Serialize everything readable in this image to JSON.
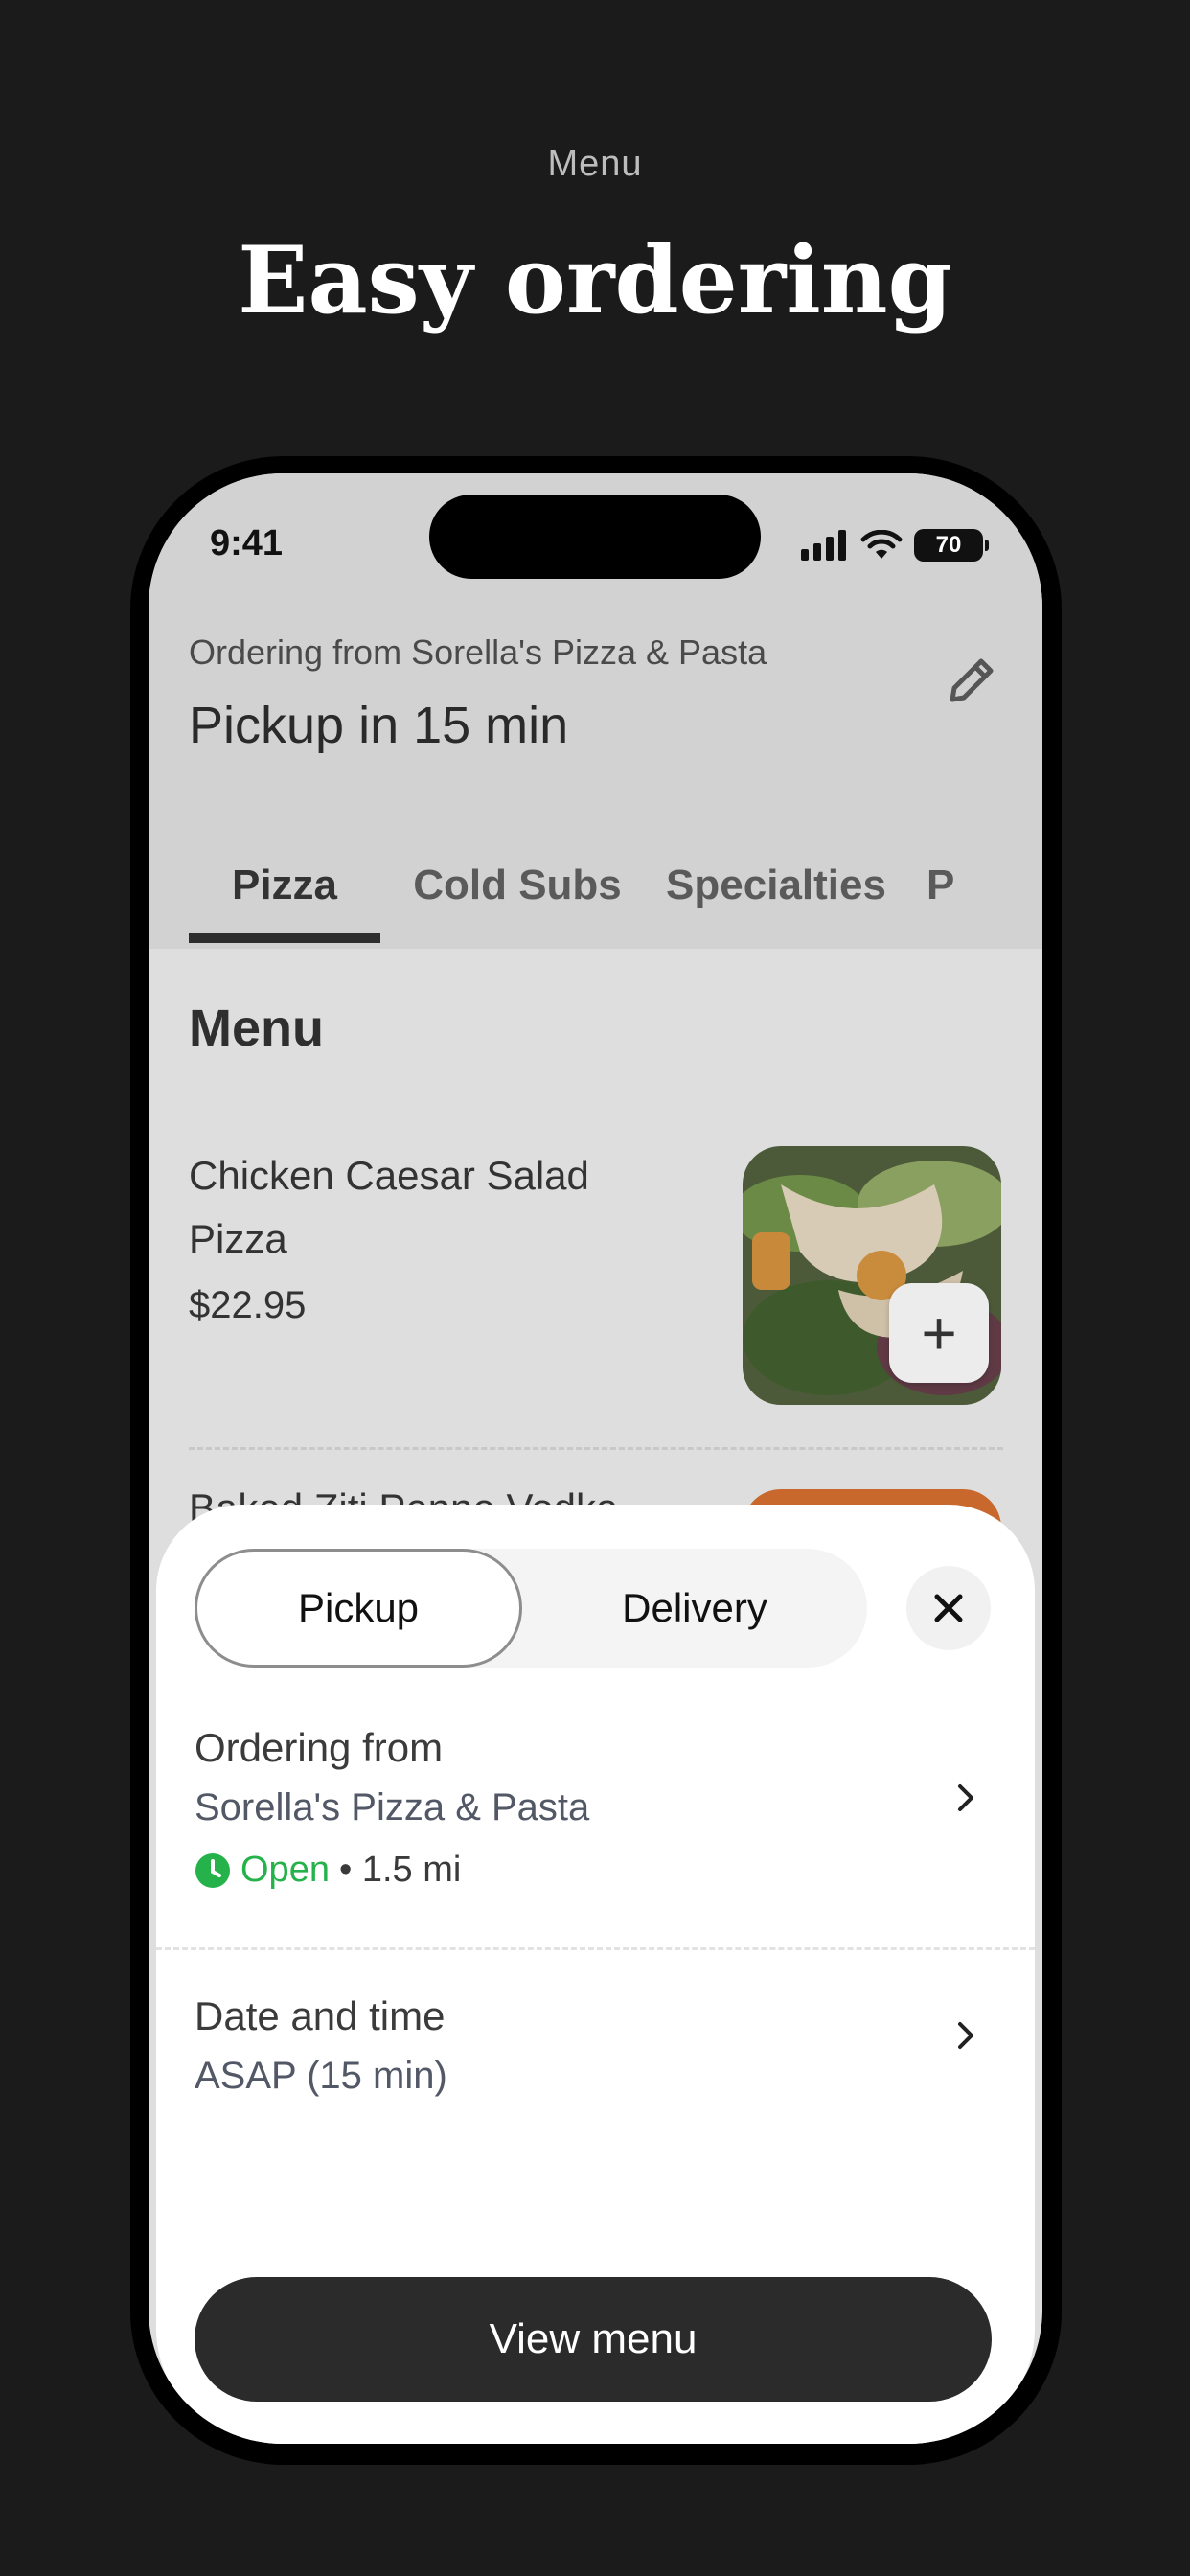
{
  "page": {
    "eyebrow": "Menu",
    "headline": "Easy ordering"
  },
  "status_bar": {
    "time": "9:41",
    "battery": "70"
  },
  "header": {
    "ordering_from": "Ordering from Sorella's Pizza & Pasta",
    "title": "Pickup in 15 min"
  },
  "tabs": [
    "Pizza",
    "Cold Subs",
    "Specialties",
    "P"
  ],
  "menu": {
    "heading": "Menu",
    "items": [
      {
        "name": "Chicken Caesar Salad Pizza",
        "price": "$22.95"
      }
    ],
    "next_item_peek": "Baked Ziti Penne Vodka"
  },
  "sheet": {
    "segments": [
      "Pickup",
      "Delivery"
    ],
    "ordering_from_label": "Ordering from",
    "store_name": "Sorella's Pizza & Pasta",
    "open_status": "Open",
    "distance": "• 1.5 mi",
    "date_time_label": "Date and time",
    "date_time_value": "ASAP (15 min)",
    "view_menu": "View menu"
  },
  "colors": {
    "accent_open": "#25b24a",
    "primary_button": "#2b2b2b",
    "background": "#1b1b1b"
  }
}
